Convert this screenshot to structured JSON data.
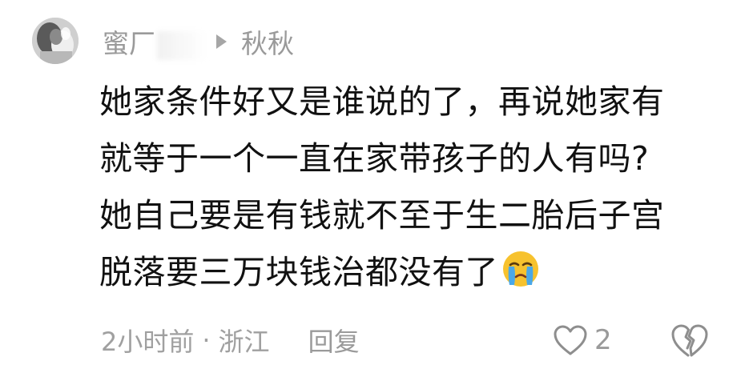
{
  "comment": {
    "author": {
      "name_visible": "蜜",
      "name_partial": "厂",
      "avatar_icon": "avatar-image"
    },
    "reply_to": "秋秋",
    "body_lines": [
      "她家条件好又是谁说的了，再说她家有",
      "就等于一个一直在家带孩子的人有吗?",
      "她自己要是有钱就不至于生二胎后子宫",
      "脱落要三万块钱治都没有了"
    ],
    "emoji": "crying-face",
    "time": "2小时前",
    "separator": "·",
    "location": "浙江",
    "reply_label": "回复",
    "like_count": "2",
    "like_icon": "heart-outline-icon",
    "dislike_icon": "broken-heart-icon"
  },
  "colors": {
    "text": "#111111",
    "meta": "#9a9a9a",
    "emoji_face": "#f7c22e",
    "emoji_tears": "#4aa8e8"
  }
}
